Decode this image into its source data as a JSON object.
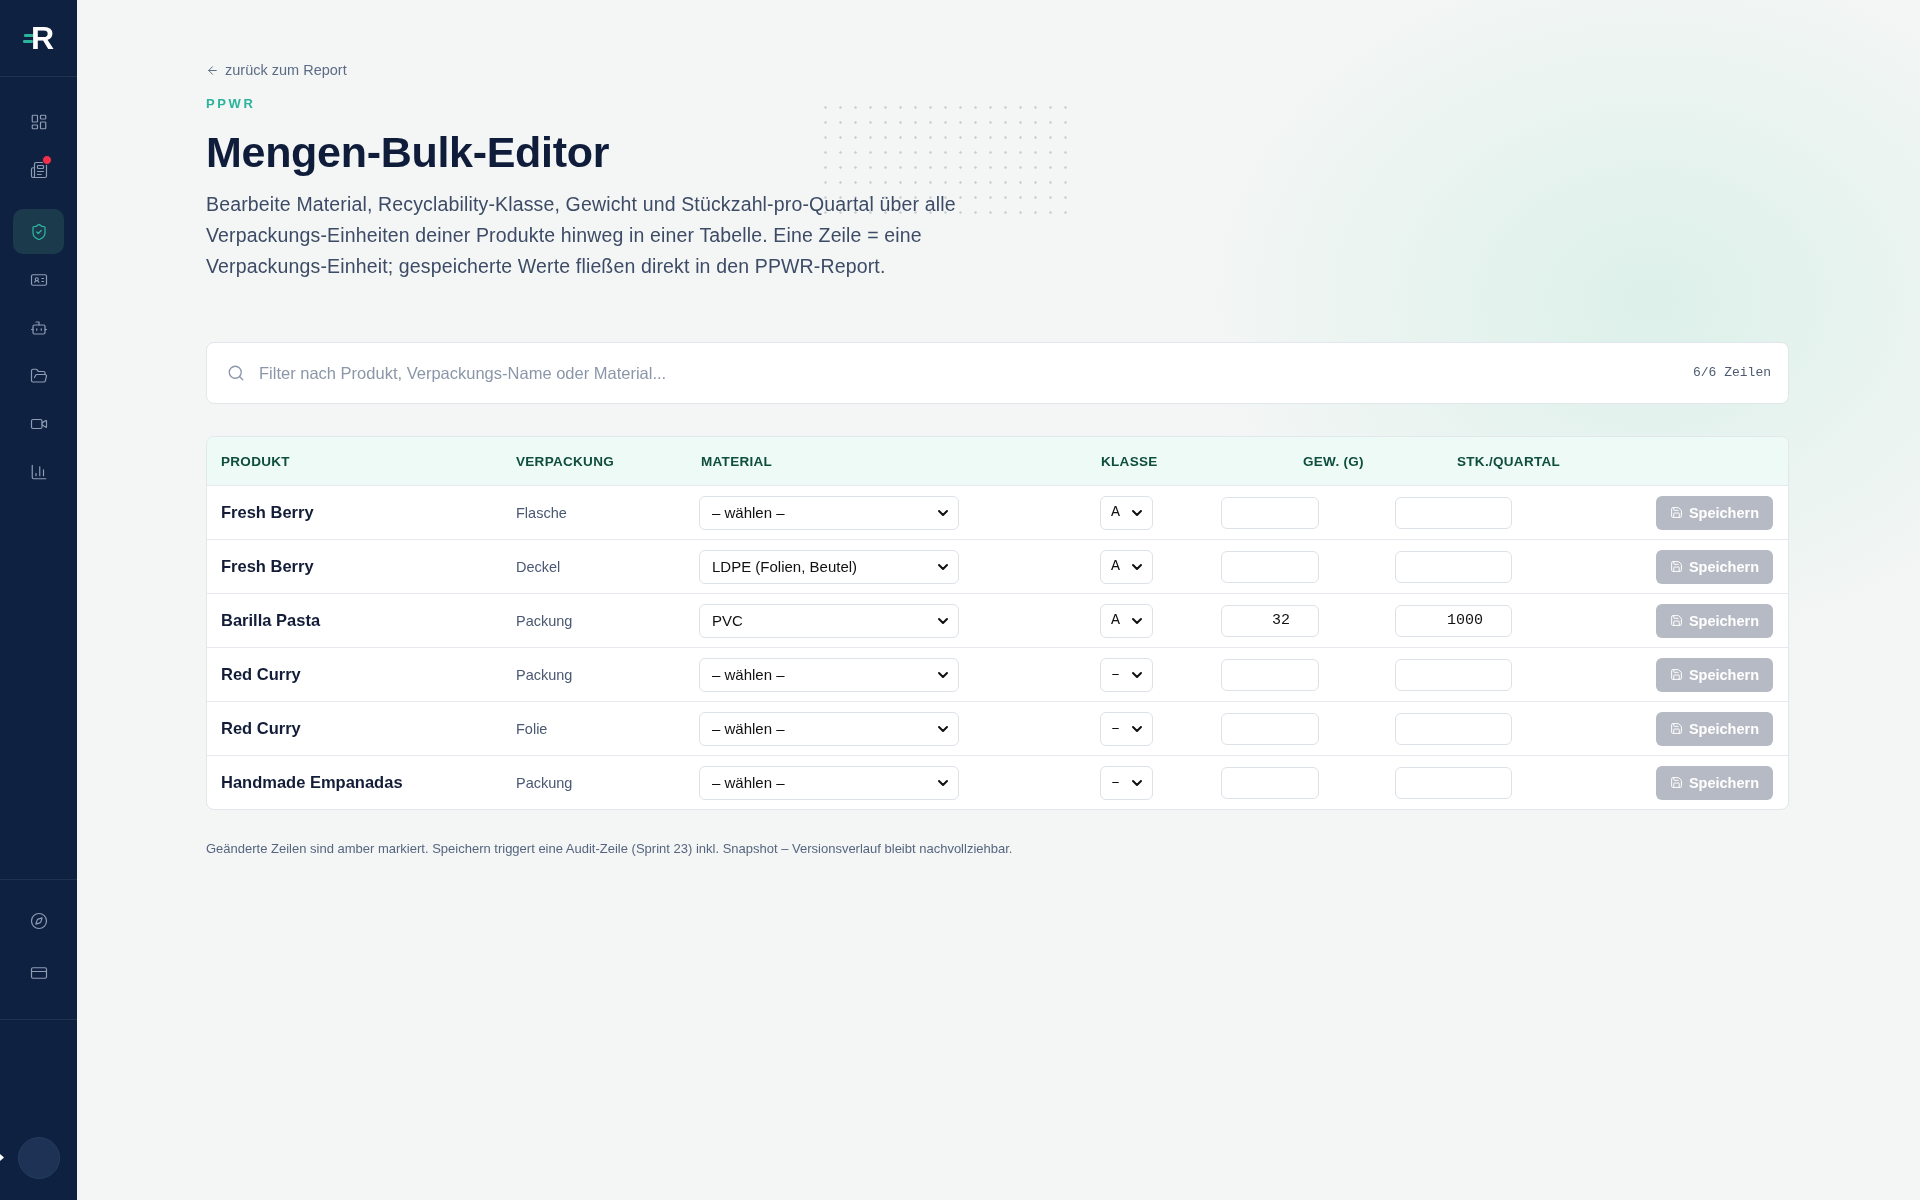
{
  "sidebar": {
    "logo": "R",
    "nav_items": [
      {
        "selected": false,
        "alert": false
      },
      {
        "selected": false,
        "alert": true
      },
      {
        "selected": true,
        "alert": false
      },
      {
        "selected": false,
        "alert": false
      },
      {
        "selected": false,
        "alert": false
      },
      {
        "selected": false,
        "alert": false
      },
      {
        "selected": false,
        "alert": false
      },
      {
        "selected": false,
        "alert": false
      }
    ],
    "bottom_items": [
      {
        "selected": false
      },
      {
        "selected": false
      }
    ]
  },
  "back_link": "zurück zum Report",
  "eyebrow": "PPWR",
  "title": "Mengen-Bulk-Editor",
  "description": "Bearbeite Material, Recyclability-Klasse, Gewicht und Stückzahl-pro-Quartal über alle Verpackungs-Einheiten deiner Produkte hinweg in einer Tabelle. Eine Zeile = eine Verpackungs-Einheit; gespeicherte Werte fließen direkt in den PPWR-Report.",
  "search": {
    "placeholder": "Filter nach Produkt, Verpackungs-Name oder Material...",
    "count": "6/6 Zeilen"
  },
  "table": {
    "columns": [
      "PRODUKT",
      "VERPACKUNG",
      "MATERIAL",
      "KLASSE",
      "GEW. (G)",
      "STK./QUARTAL"
    ],
    "rows": [
      {
        "product": "Fresh Berry",
        "packaging": "Flasche",
        "material": "– wählen –",
        "class": "A",
        "save": {
          "label": "Speichern",
          "disabled": true
        }
      },
      {
        "product": "Fresh Berry",
        "packaging": "Deckel",
        "material": "LDPE (Folien, Beutel)",
        "class": "A",
        "save": {
          "label": "Speichern",
          "disabled": true
        }
      },
      {
        "product": "Barilla Pasta",
        "packaging": "Packung",
        "material": "PVC",
        "class": "A",
        "weight": "32",
        "quantity": "1000",
        "save": {
          "label": "Speichern",
          "disabled": true
        }
      },
      {
        "product": "Red Curry",
        "packaging": "Packung",
        "material": "– wählen –",
        "class": "–",
        "save": {
          "label": "Speichern",
          "disabled": true
        }
      },
      {
        "product": "Red Curry",
        "packaging": "Folie",
        "material": "– wählen –",
        "class": "–",
        "save": {
          "label": "Speichern",
          "disabled": true
        }
      },
      {
        "product": "Handmade Empanadas",
        "packaging": "Packung",
        "material": "– wählen –",
        "class": "–",
        "save": {
          "label": "Speichern",
          "disabled": true
        }
      }
    ]
  },
  "footnote": "Geänderte Zeilen sind amber markiert. Speichern triggert eine Audit-Zeile (Sprint 23) inkl. Snapshot – Versionsverlauf bleibt nachvollziehbar."
}
